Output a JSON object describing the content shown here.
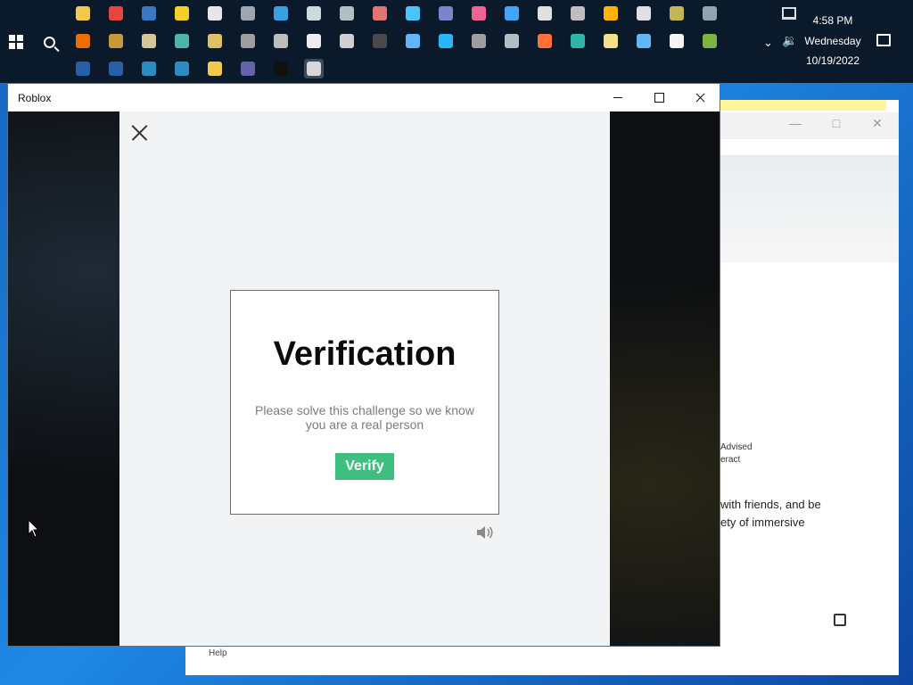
{
  "taskbar": {
    "row1_icons": [
      {
        "name": "file-explorer-icon",
        "color": "#f2c94c"
      },
      {
        "name": "chrome-icon",
        "color": "#e8453c"
      },
      {
        "name": "remote-desktop-icon",
        "color": "#3b78c2"
      },
      {
        "name": "sticky-notes-icon",
        "color": "#f5d02a"
      },
      {
        "name": "settings-icon",
        "color": "#e6e6e6"
      },
      {
        "name": "cloud-icon",
        "color": "#9ea7b1"
      },
      {
        "name": "internet-explorer-icon",
        "color": "#3aa0e3"
      },
      {
        "name": "snipping-tool-icon",
        "color": "#cfd8dc"
      },
      {
        "name": "notepad-icon",
        "color": "#b0bec5"
      },
      {
        "name": "paint-icon",
        "color": "#e57373"
      },
      {
        "name": "network-icon",
        "color": "#4fc3f7"
      },
      {
        "name": "device-manager-icon",
        "color": "#7986cb"
      },
      {
        "name": "mixed-reality-icon",
        "color": "#f06292"
      },
      {
        "name": "control-panel-icon",
        "color": "#42a5f5"
      },
      {
        "name": "calendar-icon",
        "color": "#e0e0e0"
      },
      {
        "name": "printer-icon",
        "color": "#bdbdbd"
      },
      {
        "name": "media-player-icon",
        "color": "#ffb300"
      },
      {
        "name": "document-icon",
        "color": "#e0e0e0"
      },
      {
        "name": "disk-icon",
        "color": "#c5b358"
      },
      {
        "name": "system-icon",
        "color": "#90a4ae"
      }
    ],
    "row2_icons": [
      {
        "name": "archive-icon",
        "color": "#ef6c00"
      },
      {
        "name": "drawer-icon",
        "color": "#c49a3a"
      },
      {
        "name": "word-doc-icon",
        "color": "#d7c69a"
      },
      {
        "name": "search-files-icon",
        "color": "#4db6ac"
      },
      {
        "name": "clipboard-icon",
        "color": "#e0c066"
      },
      {
        "name": "server-icon",
        "color": "#9e9e9e"
      },
      {
        "name": "drive-icon",
        "color": "#bdbdbd"
      },
      {
        "name": "no-entry-icon",
        "color": "#eeeeee"
      },
      {
        "name": "print-queue-icon",
        "color": "#cfcfcf"
      },
      {
        "name": "terminal-icon",
        "color": "#4a4a4a"
      },
      {
        "name": "monitor-icon",
        "color": "#64b5f6"
      },
      {
        "name": "cortana-icon",
        "color": "#29b6f6"
      },
      {
        "name": "calculator-icon",
        "color": "#9e9e9e"
      },
      {
        "name": "camera-icon",
        "color": "#b0bec5"
      },
      {
        "name": "firefox-icon",
        "color": "#ff7139"
      },
      {
        "name": "edge-icon",
        "color": "#2fb5a7"
      },
      {
        "name": "notes-icon",
        "color": "#f5e08a"
      },
      {
        "name": "gear-blue-icon",
        "color": "#64b5f6"
      },
      {
        "name": "shield-icon",
        "color": "#f5f5f5"
      },
      {
        "name": "battery-icon",
        "color": "#7cb342"
      }
    ],
    "row3_icons": [
      {
        "name": "powershell-icon",
        "color": "#2a5ea8"
      },
      {
        "name": "powershell-2-icon",
        "color": "#2a5ea8"
      },
      {
        "name": "powershell-ise-icon",
        "color": "#2c8bbf"
      },
      {
        "name": "powershell-ise-2-icon",
        "color": "#2c8bbf"
      },
      {
        "name": "microsoft-store-icon",
        "color": "#f2c94c"
      },
      {
        "name": "teams-icon",
        "color": "#6264a7"
      },
      {
        "name": "tiktok-icon",
        "color": "#111111"
      },
      {
        "name": "roblox-icon",
        "color": "#d9d9d9"
      }
    ],
    "tray": {
      "time": "4:58 PM",
      "day": "Wednesday",
      "date": "10/19/2022"
    }
  },
  "bg_window": {
    "rating_line1": "Advised",
    "rating_line2": "eract",
    "description": "with friends, and be\nety of immersive",
    "help_label": "Help"
  },
  "roblox_window": {
    "title": "Roblox",
    "modal": {
      "title": "Verification",
      "message": "Please solve this challenge so we know you are a real person",
      "verify_label": "Verify",
      "accent_color": "#3fbf7f"
    }
  }
}
